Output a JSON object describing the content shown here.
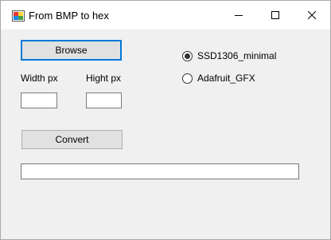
{
  "window": {
    "title": "From BMP to hex"
  },
  "form": {
    "browse_label": "Browse",
    "convert_label": "Convert",
    "width_label": "Width px",
    "hight_label": "Hight px",
    "width_value": "",
    "hight_value": "",
    "output_value": ""
  },
  "radios": [
    {
      "label": "SSD1306_minimal",
      "checked": true
    },
    {
      "label": "Adafruit_GFX",
      "checked": false
    }
  ]
}
